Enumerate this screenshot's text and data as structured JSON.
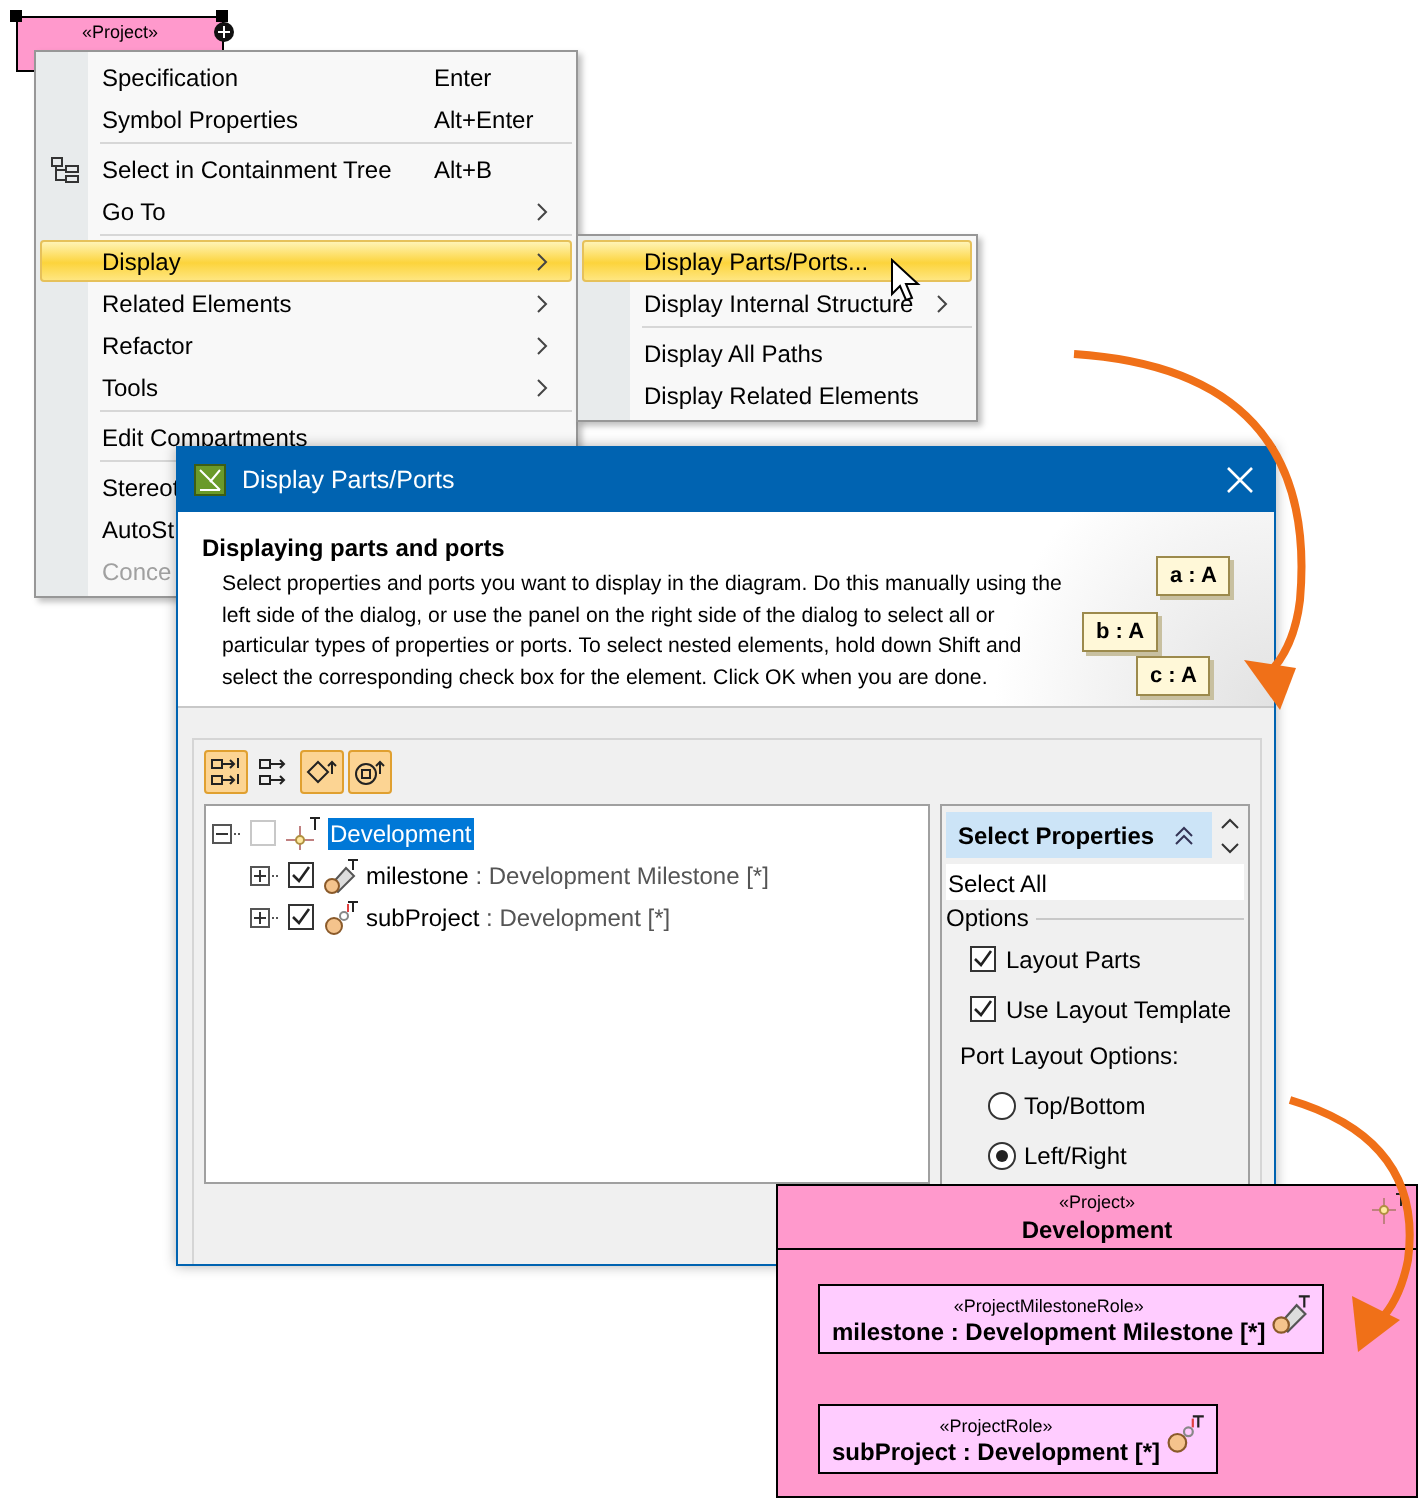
{
  "diagram_element": {
    "stereotype": "«Project»"
  },
  "context_menu": {
    "groups": [
      [
        {
          "label": "Specification",
          "shortcut": "Enter",
          "submenu": false,
          "selected": false,
          "disabled": false,
          "icon": false
        },
        {
          "label": "Symbol Properties",
          "shortcut": "Alt+Enter",
          "submenu": false,
          "selected": false,
          "disabled": false,
          "icon": false
        }
      ],
      [
        {
          "label": "Select in Containment Tree",
          "shortcut": "Alt+B",
          "submenu": false,
          "selected": false,
          "disabled": false,
          "icon": true
        },
        {
          "label": "Go To",
          "submenu": true,
          "selected": false,
          "disabled": false,
          "icon": false
        }
      ],
      [
        {
          "label": "Display",
          "submenu": true,
          "selected": true,
          "disabled": false,
          "icon": false
        },
        {
          "label": "Related Elements",
          "submenu": true,
          "selected": false,
          "disabled": false,
          "icon": false
        },
        {
          "label": "Refactor",
          "submenu": true,
          "selected": false,
          "disabled": false,
          "icon": false
        },
        {
          "label": "Tools",
          "submenu": true,
          "selected": false,
          "disabled": false,
          "icon": false
        }
      ],
      [
        {
          "label": "Edit Compartments",
          "submenu": false,
          "selected": false,
          "disabled": false,
          "icon": false
        }
      ],
      [
        {
          "label": "Stereot",
          "selected": false,
          "disabled": false
        },
        {
          "label": "AutoSt",
          "selected": false,
          "disabled": false
        },
        {
          "label": "Conce",
          "selected": false,
          "disabled": true
        }
      ]
    ]
  },
  "submenu": {
    "groups": [
      [
        {
          "label": "Display Parts/Ports...",
          "submenu": false,
          "selected": true
        },
        {
          "label": "Display Internal Structure",
          "submenu": true,
          "selected": false
        }
      ],
      [
        {
          "label": "Display All Paths",
          "submenu": false,
          "selected": false
        },
        {
          "label": "Display Related Elements",
          "submenu": false,
          "selected": false
        }
      ]
    ]
  },
  "dialog": {
    "title": "Display Parts/Ports",
    "heading": "Displaying parts and ports",
    "description": "Select properties and ports you want to display in the diagram. Do this manually using the left side of the dialog, or use the panel on the right side of the dialog to select all or particular types of properties or ports. To select nested elements, hold down Shift and select the corresponding check box for the element. Click OK when you are done.",
    "illustration_labels": [
      "a : A",
      "b : A",
      "c : A"
    ],
    "toolbar": [
      {
        "kind": "expand",
        "on": true
      },
      {
        "kind": "collapse",
        "on": false
      },
      {
        "kind": "part",
        "on": true
      },
      {
        "kind": "port",
        "on": true
      }
    ],
    "tree": {
      "name": "Development",
      "checked": false,
      "expanded": true,
      "selected": true,
      "children": [
        {
          "kind": "milestone",
          "name": "milestone",
          "type": " : Development Milestone [*]",
          "checked": true,
          "expanded": false
        },
        {
          "kind": "role",
          "name": "subProject",
          "type": " : Development [*]",
          "checked": true,
          "expanded": false
        }
      ]
    },
    "properties_panel": {
      "title": "Select Properties",
      "select_all": "Select All",
      "options_label": "Options",
      "checkboxes": [
        {
          "label": "Layout Parts",
          "checked": true
        },
        {
          "label": "Use Layout Template",
          "checked": true
        }
      ],
      "port_layout_label": "Port Layout Options:",
      "radios": [
        {
          "label": "Top/Bottom",
          "selected": false
        },
        {
          "label": "Left/Right",
          "selected": true
        }
      ]
    }
  },
  "result_diagram": {
    "stereotype": "«Project»",
    "name": "Development",
    "parts": [
      {
        "kind": "milestone",
        "stereotype": "«ProjectMilestoneRole»",
        "label": "milestone : Development Milestone [*]"
      },
      {
        "kind": "role",
        "stereotype": "«ProjectRole»",
        "label": "subProject : Development [*]"
      }
    ]
  }
}
